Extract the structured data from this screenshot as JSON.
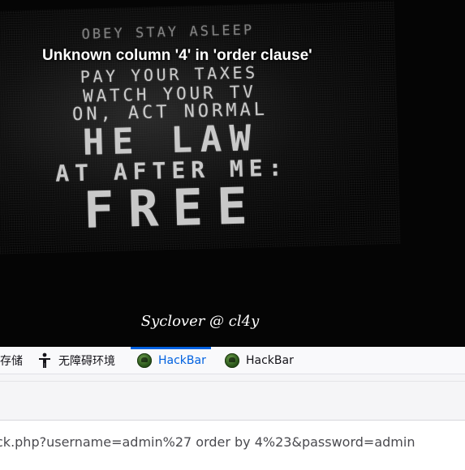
{
  "page": {
    "error_message": "Unknown column '4' in 'order clause'",
    "credit": "Syclover @ cl4y"
  },
  "poster": {
    "lines": [
      "OBEY STAY ASLEEP",
      "PAY YOUR TAXES",
      "WATCH YOUR TV",
      "ON, ACT NORMAL",
      "HE LAW",
      "AT AFTER ME:",
      "FREE"
    ]
  },
  "devtools": {
    "tabs": [
      {
        "label": "存储",
        "icon": "storage-icon"
      },
      {
        "label": "无障碍环境",
        "icon": "accessibility-icon"
      },
      {
        "label": "HackBar",
        "icon": "hackbar-icon",
        "active": true
      },
      {
        "label": "HackBar",
        "icon": "hackbar-icon"
      }
    ],
    "active_color": "#0061e0"
  },
  "hackbar": {
    "url": "ck.php?username=admin%27 order by 4%23&password=admin"
  }
}
